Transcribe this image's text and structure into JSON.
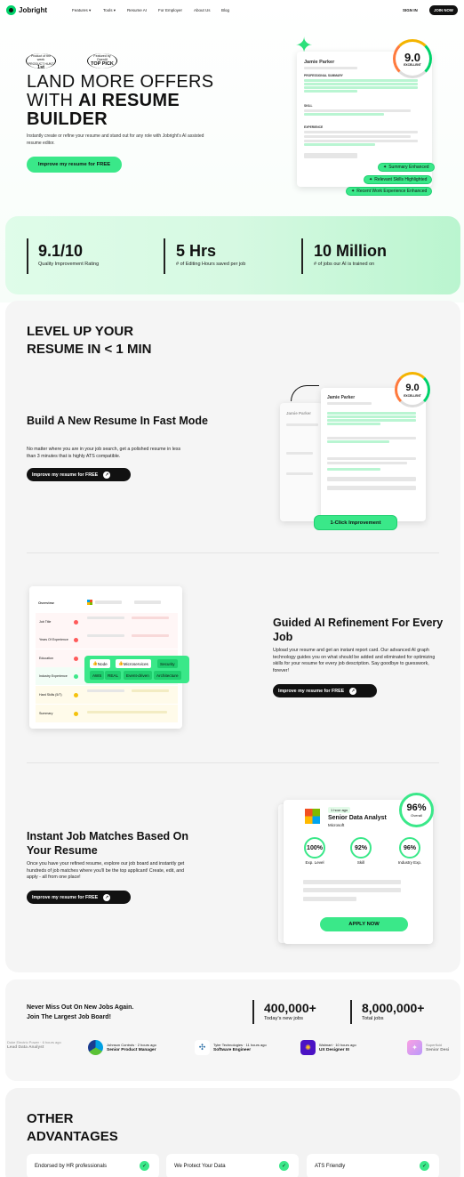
{
  "nav": {
    "brand": "Jobright",
    "items": [
      "Features",
      "Tools",
      "Resume AI",
      "For Employer",
      "About Us",
      "Blog"
    ],
    "sign_in": "SIGN IN",
    "join": "JOIN NOW"
  },
  "hero": {
    "award1_top": "Product of the week",
    "award1_mid": "PRODUCT HUNT",
    "award1_rank": "1st",
    "award2_top": "Featured by",
    "award2_mid": "OpenAI",
    "award2_rank": "TOP PICK",
    "title_line1": "LAND MORE OFFERS",
    "title_line2_a": "WITH ",
    "title_line2_b": "AI RESUME",
    "title_line3": "BUILDER",
    "subtitle": "Instantly create or refine your resume and stand out for any role with Jobright's AI assisted resume editor.",
    "cta": "Improve my resume for FREE",
    "resume_name": "Jamie Parker",
    "score": "9.0",
    "score_label": "EXCELLENT",
    "section_summary": "PROFESSIONAL SUMMARY",
    "section_skill": "SKILL",
    "section_experience": "EXPERIENCE",
    "chips": [
      "Summary Enhanced",
      "Relevant Skills Highlighted",
      "Recent Work Experience Enhanced"
    ]
  },
  "stats": [
    {
      "value": "9.1/10",
      "label": "Quality Improvement Rating"
    },
    {
      "value": "5 Hrs",
      "label": "# of Editing Hours saved per job"
    },
    {
      "value": "10 Million",
      "label": "# of jobs our AI is trained on"
    }
  ],
  "features": {
    "heading_line1": "LEVEL UP YOUR",
    "heading_line2": "RESUME IN < 1 MIN",
    "f1_title": "Build A New Resume In Fast Mode",
    "f1_desc": "No matter where you are in your job search, get a polished resume in less than 3 minutes that is highly ATS compatible.",
    "f1_cta": "Improve my resume for FREE",
    "f1_badge": "1-Click Improvement",
    "f1_score": "9.0",
    "f1_score_label": "EXCELLENT",
    "f1_resume_name": "Jamie Parker",
    "f2_title": "Guided AI Refinement For Every Job",
    "f2_desc": "Upload your resume and get an instant report card. Our advanced AI graph technology guides you on what should be added and eliminated for optimizing skills for your resume for every job description. Say goodbye to guesswork, forever!",
    "f2_cta": "Improve my resume for FREE",
    "f2_table_header": "Overview",
    "f2_rows": [
      "Job Title",
      "Years Of Experience",
      "Education",
      "Industry Experience",
      "Hard Skills (5/7)",
      "Summary"
    ],
    "f2_tags": [
      "Node",
      "Microservices",
      "Security",
      "AWS",
      "REAL",
      "Event-driven",
      "Architecture"
    ],
    "f3_title": "Instant Job Matches Based On Your Resume",
    "f3_desc": "Once you have your refined resume, explore our job board and instantly get hundreds of job matches where you'll be the top applicant! Create, edit, and apply - all from one place!",
    "f3_cta": "Improve my resume for FREE",
    "f3_time": "1 hour ago",
    "f3_job": "Senior Data Analyst",
    "f3_company": "Microsoft",
    "f3_overall": "96%",
    "f3_overall_label": "Overall",
    "f3_metrics": [
      {
        "value": "100%",
        "label": "Exp. Level"
      },
      {
        "value": "92%",
        "label": "Skill"
      },
      {
        "value": "96%",
        "label": "Industry Exp."
      }
    ],
    "f3_apply": "APPLY NOW"
  },
  "jobs": {
    "line1": "Never Miss Out On New Jobs Again.",
    "line2": "Join The Largest Job Board!",
    "today_value": "400,000+",
    "today_label": "Today's new jobs",
    "total_value": "8,000,000+",
    "total_label": "Total jobs",
    "items": [
      {
        "company": "Johnson Controls",
        "time": "2 hours ago",
        "role": "Senior Product Manager"
      },
      {
        "company": "Tyler Technologies",
        "time": "11 hours ago",
        "role": "Software Engineer"
      },
      {
        "company": "Walmart",
        "time": "10 hours ago",
        "role": "UX Designer III"
      }
    ],
    "partial_left_company": "Duke Electric Power",
    "partial_left_time": "6 hours ago",
    "partial_left_role": "Lead Data Analyst",
    "partial_right_company": "Superfluid",
    "partial_right_role": "Senior Desi"
  },
  "advantages": {
    "heading_line1": "OTHER",
    "heading_line2": "ADVANTAGES",
    "cards": [
      "Endorsed by HR professionals",
      "We Protect Your Data",
      "ATS Friendly"
    ]
  },
  "colors": {
    "accent": "#3ae889",
    "dark": "#111111",
    "panel": "#f5f5f5"
  }
}
